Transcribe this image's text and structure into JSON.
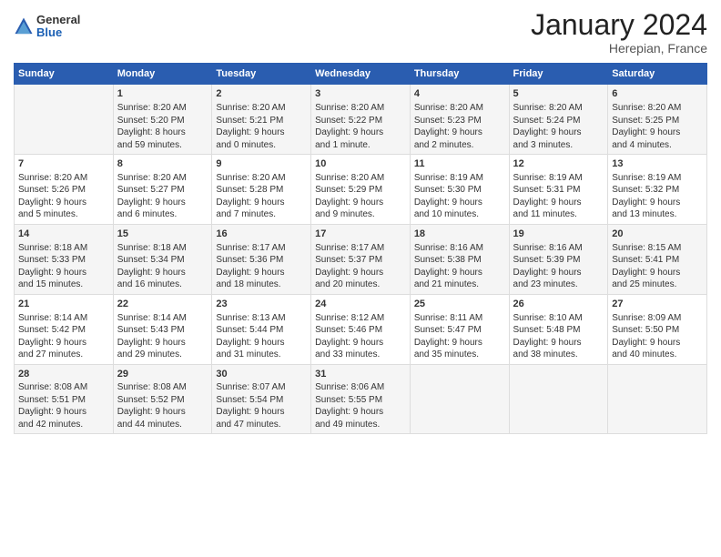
{
  "header": {
    "logo": {
      "general": "General",
      "blue": "Blue"
    },
    "title": "January 2024",
    "subtitle": "Herepian, France"
  },
  "calendar": {
    "columns": [
      "Sunday",
      "Monday",
      "Tuesday",
      "Wednesday",
      "Thursday",
      "Friday",
      "Saturday"
    ],
    "rows": [
      [
        {
          "day": "",
          "lines": []
        },
        {
          "day": "1",
          "lines": [
            "Sunrise: 8:20 AM",
            "Sunset: 5:20 PM",
            "Daylight: 8 hours",
            "and 59 minutes."
          ]
        },
        {
          "day": "2",
          "lines": [
            "Sunrise: 8:20 AM",
            "Sunset: 5:21 PM",
            "Daylight: 9 hours",
            "and 0 minutes."
          ]
        },
        {
          "day": "3",
          "lines": [
            "Sunrise: 8:20 AM",
            "Sunset: 5:22 PM",
            "Daylight: 9 hours",
            "and 1 minute."
          ]
        },
        {
          "day": "4",
          "lines": [
            "Sunrise: 8:20 AM",
            "Sunset: 5:23 PM",
            "Daylight: 9 hours",
            "and 2 minutes."
          ]
        },
        {
          "day": "5",
          "lines": [
            "Sunrise: 8:20 AM",
            "Sunset: 5:24 PM",
            "Daylight: 9 hours",
            "and 3 minutes."
          ]
        },
        {
          "day": "6",
          "lines": [
            "Sunrise: 8:20 AM",
            "Sunset: 5:25 PM",
            "Daylight: 9 hours",
            "and 4 minutes."
          ]
        }
      ],
      [
        {
          "day": "7",
          "lines": [
            "Sunrise: 8:20 AM",
            "Sunset: 5:26 PM",
            "Daylight: 9 hours",
            "and 5 minutes."
          ]
        },
        {
          "day": "8",
          "lines": [
            "Sunrise: 8:20 AM",
            "Sunset: 5:27 PM",
            "Daylight: 9 hours",
            "and 6 minutes."
          ]
        },
        {
          "day": "9",
          "lines": [
            "Sunrise: 8:20 AM",
            "Sunset: 5:28 PM",
            "Daylight: 9 hours",
            "and 7 minutes."
          ]
        },
        {
          "day": "10",
          "lines": [
            "Sunrise: 8:20 AM",
            "Sunset: 5:29 PM",
            "Daylight: 9 hours",
            "and 9 minutes."
          ]
        },
        {
          "day": "11",
          "lines": [
            "Sunrise: 8:19 AM",
            "Sunset: 5:30 PM",
            "Daylight: 9 hours",
            "and 10 minutes."
          ]
        },
        {
          "day": "12",
          "lines": [
            "Sunrise: 8:19 AM",
            "Sunset: 5:31 PM",
            "Daylight: 9 hours",
            "and 11 minutes."
          ]
        },
        {
          "day": "13",
          "lines": [
            "Sunrise: 8:19 AM",
            "Sunset: 5:32 PM",
            "Daylight: 9 hours",
            "and 13 minutes."
          ]
        }
      ],
      [
        {
          "day": "14",
          "lines": [
            "Sunrise: 8:18 AM",
            "Sunset: 5:33 PM",
            "Daylight: 9 hours",
            "and 15 minutes."
          ]
        },
        {
          "day": "15",
          "lines": [
            "Sunrise: 8:18 AM",
            "Sunset: 5:34 PM",
            "Daylight: 9 hours",
            "and 16 minutes."
          ]
        },
        {
          "day": "16",
          "lines": [
            "Sunrise: 8:17 AM",
            "Sunset: 5:36 PM",
            "Daylight: 9 hours",
            "and 18 minutes."
          ]
        },
        {
          "day": "17",
          "lines": [
            "Sunrise: 8:17 AM",
            "Sunset: 5:37 PM",
            "Daylight: 9 hours",
            "and 20 minutes."
          ]
        },
        {
          "day": "18",
          "lines": [
            "Sunrise: 8:16 AM",
            "Sunset: 5:38 PM",
            "Daylight: 9 hours",
            "and 21 minutes."
          ]
        },
        {
          "day": "19",
          "lines": [
            "Sunrise: 8:16 AM",
            "Sunset: 5:39 PM",
            "Daylight: 9 hours",
            "and 23 minutes."
          ]
        },
        {
          "day": "20",
          "lines": [
            "Sunrise: 8:15 AM",
            "Sunset: 5:41 PM",
            "Daylight: 9 hours",
            "and 25 minutes."
          ]
        }
      ],
      [
        {
          "day": "21",
          "lines": [
            "Sunrise: 8:14 AM",
            "Sunset: 5:42 PM",
            "Daylight: 9 hours",
            "and 27 minutes."
          ]
        },
        {
          "day": "22",
          "lines": [
            "Sunrise: 8:14 AM",
            "Sunset: 5:43 PM",
            "Daylight: 9 hours",
            "and 29 minutes."
          ]
        },
        {
          "day": "23",
          "lines": [
            "Sunrise: 8:13 AM",
            "Sunset: 5:44 PM",
            "Daylight: 9 hours",
            "and 31 minutes."
          ]
        },
        {
          "day": "24",
          "lines": [
            "Sunrise: 8:12 AM",
            "Sunset: 5:46 PM",
            "Daylight: 9 hours",
            "and 33 minutes."
          ]
        },
        {
          "day": "25",
          "lines": [
            "Sunrise: 8:11 AM",
            "Sunset: 5:47 PM",
            "Daylight: 9 hours",
            "and 35 minutes."
          ]
        },
        {
          "day": "26",
          "lines": [
            "Sunrise: 8:10 AM",
            "Sunset: 5:48 PM",
            "Daylight: 9 hours",
            "and 38 minutes."
          ]
        },
        {
          "day": "27",
          "lines": [
            "Sunrise: 8:09 AM",
            "Sunset: 5:50 PM",
            "Daylight: 9 hours",
            "and 40 minutes."
          ]
        }
      ],
      [
        {
          "day": "28",
          "lines": [
            "Sunrise: 8:08 AM",
            "Sunset: 5:51 PM",
            "Daylight: 9 hours",
            "and 42 minutes."
          ]
        },
        {
          "day": "29",
          "lines": [
            "Sunrise: 8:08 AM",
            "Sunset: 5:52 PM",
            "Daylight: 9 hours",
            "and 44 minutes."
          ]
        },
        {
          "day": "30",
          "lines": [
            "Sunrise: 8:07 AM",
            "Sunset: 5:54 PM",
            "Daylight: 9 hours",
            "and 47 minutes."
          ]
        },
        {
          "day": "31",
          "lines": [
            "Sunrise: 8:06 AM",
            "Sunset: 5:55 PM",
            "Daylight: 9 hours",
            "and 49 minutes."
          ]
        },
        {
          "day": "",
          "lines": []
        },
        {
          "day": "",
          "lines": []
        },
        {
          "day": "",
          "lines": []
        }
      ]
    ]
  }
}
